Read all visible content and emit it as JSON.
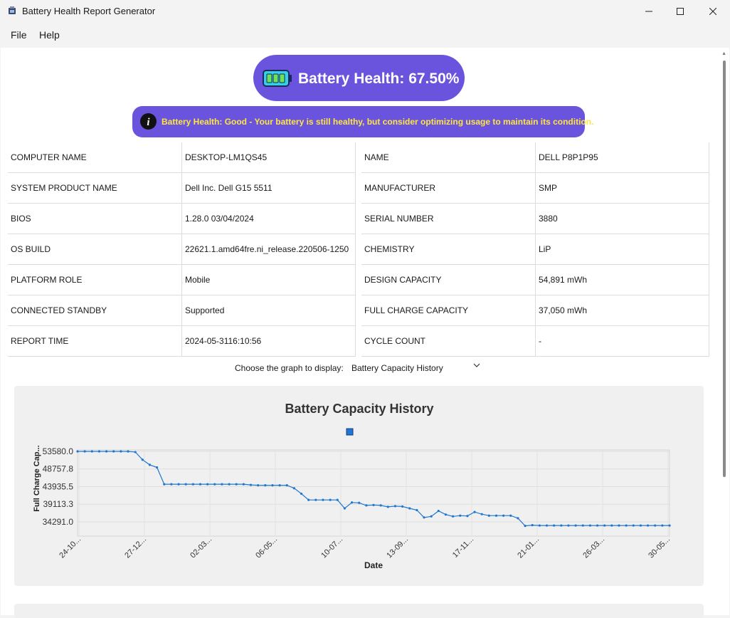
{
  "window": {
    "title": "Battery Health Report Generator"
  },
  "menu": {
    "items": [
      "File",
      "Help"
    ]
  },
  "health": {
    "label": "Battery Health: 67.50%",
    "message": "Battery Health: Good - Your battery is still healthy, but consider optimizing usage to maintain its condition.",
    "pill_color": "#6a54de",
    "message_color": "#ffe63b"
  },
  "system_info": [
    {
      "label": "COMPUTER NAME",
      "value": "DESKTOP-LM1QS45"
    },
    {
      "label": "SYSTEM PRODUCT NAME",
      "value": "Dell Inc. Dell G15 5511"
    },
    {
      "label": "BIOS",
      "value": "1.28.0 03/04/2024"
    },
    {
      "label": "OS BUILD",
      "value": "22621.1.amd64fre.ni_release.220506-1250"
    },
    {
      "label": "PLATFORM ROLE",
      "value": "Mobile"
    },
    {
      "label": "CONNECTED STANDBY",
      "value": "Supported"
    },
    {
      "label": "REPORT TIME",
      "value": "2024-05-3116:10:56"
    }
  ],
  "battery_info": [
    {
      "label": "NAME",
      "value": "DELL P8P1P95"
    },
    {
      "label": "MANUFACTURER",
      "value": "SMP"
    },
    {
      "label": "SERIAL NUMBER",
      "value": "3880"
    },
    {
      "label": "CHEMISTRY",
      "value": "LiP"
    },
    {
      "label": "DESIGN CAPACITY",
      "value": "54,891 mWh"
    },
    {
      "label": "FULL CHARGE CAPACITY",
      "value": "37,050 mWh"
    },
    {
      "label": "CYCLE COUNT",
      "value": "-"
    }
  ],
  "graph_selector": {
    "label": "Choose the graph to display:",
    "selected": "Battery Capacity History"
  },
  "chart_data": {
    "type": "line",
    "title": "Battery Capacity History",
    "xlabel": "Date",
    "ylabel": "Full Charge Cap...",
    "x_tick_labels": [
      "24-10...",
      "27-12...",
      "02-03...",
      "06-05...",
      "10-07...",
      "13-09...",
      "17-11...",
      "21-01...",
      "26-03...",
      "30-05..."
    ],
    "y_ticks": [
      34291.0,
      39113.3,
      43935.5,
      48757.8,
      53580.0
    ],
    "ylim": [
      34291.0,
      53580.0
    ],
    "grid": true,
    "color": "#1f77d0",
    "series": [
      {
        "values": [
          53580,
          53580,
          53580,
          53580,
          53580,
          53580,
          53580,
          53580,
          53400,
          51300,
          49900,
          49200,
          44600,
          44600,
          44600,
          44600,
          44600,
          44600,
          44600,
          44600,
          44600,
          44600,
          44600,
          44600,
          44400,
          44300,
          44300,
          44300,
          44300,
          44300,
          43500,
          42000,
          40300,
          40300,
          40300,
          40300,
          40300,
          38000,
          39600,
          39500,
          38800,
          38900,
          38800,
          38400,
          38600,
          38500,
          38000,
          37500,
          35500,
          35800,
          37300,
          36300,
          35800,
          36000,
          35900,
          37000,
          36400,
          36000,
          36000,
          36000,
          36000,
          35300,
          33200,
          33400,
          33300,
          33300,
          33300,
          33300,
          33300,
          33300,
          33300,
          33300,
          33300,
          33300,
          33300,
          33300,
          33300,
          33300,
          33300,
          33300,
          33300,
          33300,
          33300
        ]
      }
    ]
  }
}
